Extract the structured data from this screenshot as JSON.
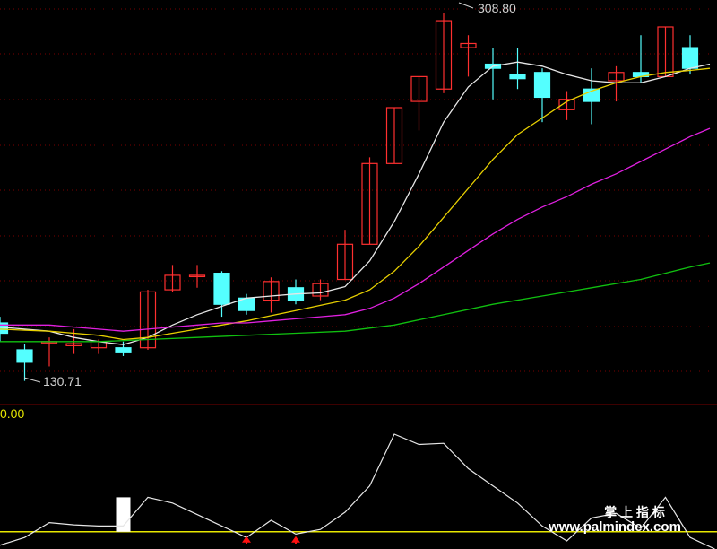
{
  "colors": {
    "background": "#000000",
    "grid": "#7a0000",
    "up_candle": "#ff3030",
    "down_candle": "#54ffff",
    "ma5": "#e6e6e6",
    "ma10": "#e8d000",
    "ma20": "#e020e0",
    "ma60": "#10c010",
    "indicator_line": "#e6e6e6",
    "indicator_baseline": "#e8e800",
    "signal_arrow": "#ff1010",
    "marker_block": "#ffffff",
    "label_text": "#d0d0d0",
    "indicator_value_text": "#e8e800",
    "watermark": "#ffffff"
  },
  "chart_data": [
    {
      "type": "candlestick",
      "annotations": {
        "high_label": "308.80",
        "low_label": "130.71"
      },
      "candles": [
        {
          "i": 0,
          "o": 159,
          "c": 154,
          "h": 162,
          "l": 150
        },
        {
          "i": 1,
          "o": 146,
          "c": 140,
          "h": 149,
          "l": 131
        },
        {
          "i": 2,
          "o": 150,
          "c": 150,
          "h": 152,
          "l": 138
        },
        {
          "i": 3,
          "o": 148,
          "c": 149,
          "h": 156,
          "l": 144
        },
        {
          "i": 4,
          "o": 147,
          "c": 150,
          "h": 151,
          "l": 144
        },
        {
          "i": 5,
          "o": 147,
          "c": 145,
          "h": 150,
          "l": 143
        },
        {
          "i": 6,
          "o": 147,
          "c": 174,
          "h": 175,
          "l": 146
        },
        {
          "i": 7,
          "o": 175,
          "c": 182,
          "h": 187,
          "l": 174
        },
        {
          "i": 8,
          "o": 182,
          "c": 182,
          "h": 187,
          "l": 176
        },
        {
          "i": 9,
          "o": 183,
          "c": 168,
          "h": 184,
          "l": 162
        },
        {
          "i": 10,
          "o": 171,
          "c": 165,
          "h": 173,
          "l": 163
        },
        {
          "i": 11,
          "o": 170,
          "c": 179,
          "h": 181,
          "l": 164
        },
        {
          "i": 12,
          "o": 176,
          "c": 170,
          "h": 180,
          "l": 168
        },
        {
          "i": 13,
          "o": 172,
          "c": 178,
          "h": 180,
          "l": 170
        },
        {
          "i": 14,
          "o": 180,
          "c": 197,
          "h": 204,
          "l": 180
        },
        {
          "i": 15,
          "o": 197,
          "c": 236,
          "h": 239,
          "l": 197
        },
        {
          "i": 16,
          "o": 236,
          "c": 263,
          "h": 263,
          "l": 236
        },
        {
          "i": 17,
          "o": 266,
          "c": 278,
          "h": 278,
          "l": 252
        },
        {
          "i": 18,
          "o": 272,
          "c": 305,
          "h": 308.8,
          "l": 270
        },
        {
          "i": 19,
          "o": 292,
          "c": 294,
          "h": 298,
          "l": 278
        },
        {
          "i": 20,
          "o": 284,
          "c": 282,
          "h": 292,
          "l": 267
        },
        {
          "i": 21,
          "o": 279,
          "c": 277,
          "h": 292,
          "l": 272
        },
        {
          "i": 22,
          "o": 280,
          "c": 268,
          "h": 282,
          "l": 256
        },
        {
          "i": 23,
          "o": 262,
          "c": 267,
          "h": 271,
          "l": 257
        },
        {
          "i": 24,
          "o": 272,
          "c": 266,
          "h": 282,
          "l": 255
        },
        {
          "i": 25,
          "o": 276,
          "c": 280,
          "h": 283,
          "l": 266
        },
        {
          "i": 26,
          "o": 280,
          "c": 278,
          "h": 298,
          "l": 275
        },
        {
          "i": 27,
          "o": 278,
          "c": 302,
          "h": 302,
          "l": 278
        },
        {
          "i": 28,
          "o": 292,
          "c": 282,
          "h": 298,
          "l": 279
        }
      ],
      "moving_averages": [
        {
          "key": "ma5",
          "color_key": "ma5",
          "values": [
            [
              0,
              157
            ],
            [
              1,
              156
            ],
            [
              2,
              155
            ],
            [
              3,
              152
            ],
            [
              4,
              150
            ],
            [
              5,
              148.5
            ],
            [
              6,
              152
            ],
            [
              7,
              158
            ],
            [
              8,
              163
            ],
            [
              9,
              167
            ],
            [
              10,
              171
            ],
            [
              11,
              172
            ],
            [
              12,
              173
            ],
            [
              13,
              173.5
            ],
            [
              14,
              176.5
            ],
            [
              15,
              189
            ],
            [
              16,
              208
            ],
            [
              17,
              231
            ],
            [
              18,
              256
            ],
            [
              19,
              273
            ],
            [
              20,
              283
            ],
            [
              21,
              285
            ],
            [
              22,
              283
            ],
            [
              23,
              279
            ],
            [
              24,
              276
            ],
            [
              25,
              275
            ],
            [
              26,
              275
            ],
            [
              27,
              278
            ],
            [
              28,
              282
            ],
            [
              28.8,
              284
            ]
          ]
        },
        {
          "key": "ma10",
          "color_key": "ma10",
          "values": [
            [
              0,
              156
            ],
            [
              1,
              155.5
            ],
            [
              2,
              155
            ],
            [
              3,
              154
            ],
            [
              4,
              153
            ],
            [
              5,
              151
            ],
            [
              6,
              152
            ],
            [
              7,
              154
            ],
            [
              8,
              156
            ],
            [
              9,
              158
            ],
            [
              10,
              160
            ],
            [
              11,
              162.5
            ],
            [
              12,
              165
            ],
            [
              13,
              167.5
            ],
            [
              14,
              170
            ],
            [
              15,
              175
            ],
            [
              16,
              184
            ],
            [
              17,
              196
            ],
            [
              18,
              210
            ],
            [
              19,
              224
            ],
            [
              20,
              238
            ],
            [
              21,
              250
            ],
            [
              22,
              258
            ],
            [
              23,
              266
            ],
            [
              24,
              271
            ],
            [
              25,
              275
            ],
            [
              26,
              278
            ],
            [
              27,
              280
            ],
            [
              28,
              281
            ],
            [
              28.8,
              282
            ]
          ]
        },
        {
          "key": "ma20",
          "color_key": "ma20",
          "values": [
            [
              0,
              158
            ],
            [
              1,
              158
            ],
            [
              2,
              158
            ],
            [
              3,
              157
            ],
            [
              4,
              156
            ],
            [
              5,
              155
            ],
            [
              6,
              156
            ],
            [
              7,
              157
            ],
            [
              8,
              158
            ],
            [
              9,
              159
            ],
            [
              10,
              159
            ],
            [
              11,
              160
            ],
            [
              12,
              161
            ],
            [
              13,
              162
            ],
            [
              14,
              163
            ],
            [
              15,
              166
            ],
            [
              16,
              171
            ],
            [
              17,
              178
            ],
            [
              18,
              186
            ],
            [
              19,
              194
            ],
            [
              20,
              202
            ],
            [
              21,
              209
            ],
            [
              22,
              215
            ],
            [
              23,
              220
            ],
            [
              24,
              226
            ],
            [
              25,
              231
            ],
            [
              26,
              237
            ],
            [
              27,
              243
            ],
            [
              28,
              249
            ],
            [
              28.8,
              253
            ]
          ]
        },
        {
          "key": "ma60",
          "color_key": "ma60",
          "values": [
            [
              0,
              150
            ],
            [
              2,
              150
            ],
            [
              4,
              150
            ],
            [
              6,
              151
            ],
            [
              8,
              152
            ],
            [
              10,
              153
            ],
            [
              12,
              154
            ],
            [
              14,
              155
            ],
            [
              16,
              158
            ],
            [
              18,
              163
            ],
            [
              20,
              168
            ],
            [
              22,
              172
            ],
            [
              24,
              176
            ],
            [
              26,
              180
            ],
            [
              28,
              186
            ],
            [
              28.8,
              188
            ]
          ]
        }
      ]
    },
    {
      "type": "line",
      "value_label": "0.00",
      "baseline": 0,
      "ylim": [
        -15,
        110
      ],
      "series": [
        {
          "values": [
            [
              -0.5,
              -15
            ],
            [
              1,
              -5
            ],
            [
              2,
              8
            ],
            [
              3,
              6
            ],
            [
              4,
              5
            ],
            [
              5,
              5
            ],
            [
              6,
              30
            ],
            [
              7,
              25
            ],
            [
              8,
              15
            ],
            [
              9,
              5
            ],
            [
              10,
              -5
            ],
            [
              11,
              10
            ],
            [
              12,
              -2
            ],
            [
              13,
              2
            ],
            [
              14,
              17
            ],
            [
              15,
              40
            ],
            [
              16,
              85
            ],
            [
              17,
              76
            ],
            [
              18,
              77
            ],
            [
              19,
              55
            ],
            [
              20,
              40
            ],
            [
              21,
              25
            ],
            [
              22,
              5
            ],
            [
              23,
              -8
            ],
            [
              24,
              12
            ],
            [
              25,
              16
            ],
            [
              26,
              3
            ],
            [
              27,
              30
            ],
            [
              28,
              -5
            ],
            [
              29,
              -15
            ]
          ]
        }
      ],
      "marker_block_index": 5,
      "signal_arrow_indices": [
        10,
        12
      ]
    }
  ],
  "watermark": {
    "line1": "掌 上 指 标",
    "line2": "www.palmindex.com"
  }
}
